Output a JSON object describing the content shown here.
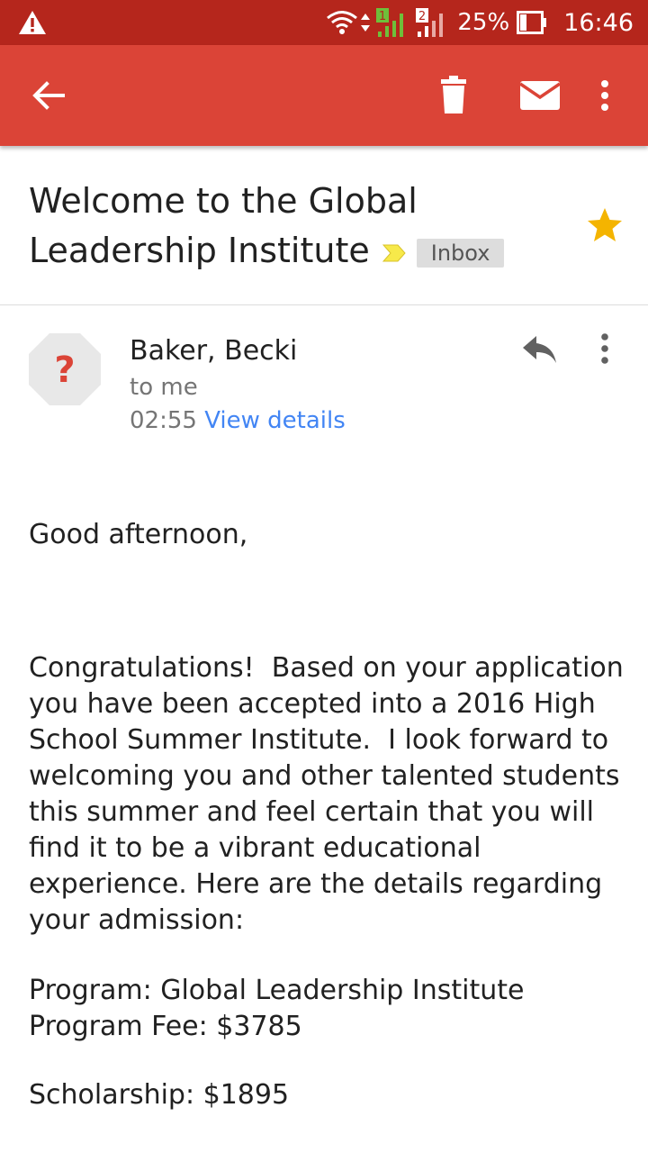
{
  "status_bar": {
    "battery_percent": "25%",
    "time": "16:46",
    "sim1": "1",
    "sim2": "2",
    "icons": [
      "warning-icon",
      "wifi-icon",
      "data-arrows-icon",
      "signal-sim1-icon",
      "signal-sim2-icon",
      "battery-icon"
    ]
  },
  "toolbar": {
    "icons": [
      "back-arrow-icon",
      "trash-icon",
      "mail-icon",
      "more-vert-icon"
    ],
    "color": "#db4437",
    "status_color": "#b5261c"
  },
  "email": {
    "subject": "Welcome to the Global Leadership Institute",
    "label": "Inbox",
    "starred": true,
    "star_color": "#f4b400",
    "sender": {
      "name": "Baker, Becki",
      "avatar_glyph": "?",
      "recipient": "to me",
      "time": "02:55",
      "details_link": "View details"
    },
    "body": {
      "greeting": "Good afternoon,",
      "paragraph": "Congratulations!  Based on your application you have been accepted into a 2016 High School Summer Institute.  I look forward to welcoming you and other talented students this summer and feel certain that you will find it to be a vibrant educational experience. Here are the details regarding your admission:",
      "program": "Program: Global Leadership Institute",
      "fee": "Program Fee: $3785",
      "scholarship": "Scholarship: $1895"
    }
  }
}
